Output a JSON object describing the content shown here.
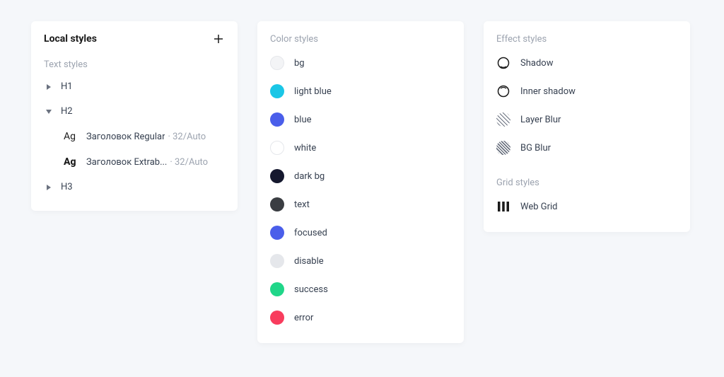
{
  "localStyles": {
    "title": "Local styles",
    "textStylesTitle": "Text styles",
    "items": {
      "h1": "H1",
      "h2": "H2",
      "h3": "H3"
    },
    "subItems": {
      "regular": {
        "label": "Заголовок Regular",
        "meta": "· 32/Auto"
      },
      "extrabold": {
        "label": "Заголовок Extrab...",
        "meta": "· 32/Auto"
      }
    }
  },
  "colorStyles": {
    "title": "Color styles",
    "items": {
      "bg": "bg",
      "lightBlue": "light blue",
      "blue": "blue",
      "white": "white",
      "darkBg": "dark bg",
      "text": "text",
      "focused": "focused",
      "disable": "disable",
      "success": "success",
      "error": "error"
    },
    "colors": {
      "bg": "#f3f4f6",
      "lightBlue": "#1ac6e6",
      "blue": "#4a5eea",
      "white": "#ffffff",
      "darkBg": "#15182e",
      "text": "#3a3d42",
      "focused": "#4a5eea",
      "disable": "#e5e7eb",
      "success": "#20d689",
      "error": "#f83c5d"
    }
  },
  "effectStyles": {
    "title": "Effect styles",
    "items": {
      "shadow": "Shadow",
      "innerShadow": "Inner shadow",
      "layerBlur": "Layer Blur",
      "bgBlur": "BG Blur"
    }
  },
  "gridStyles": {
    "title": "Grid styles",
    "items": {
      "webGrid": "Web Grid"
    }
  }
}
